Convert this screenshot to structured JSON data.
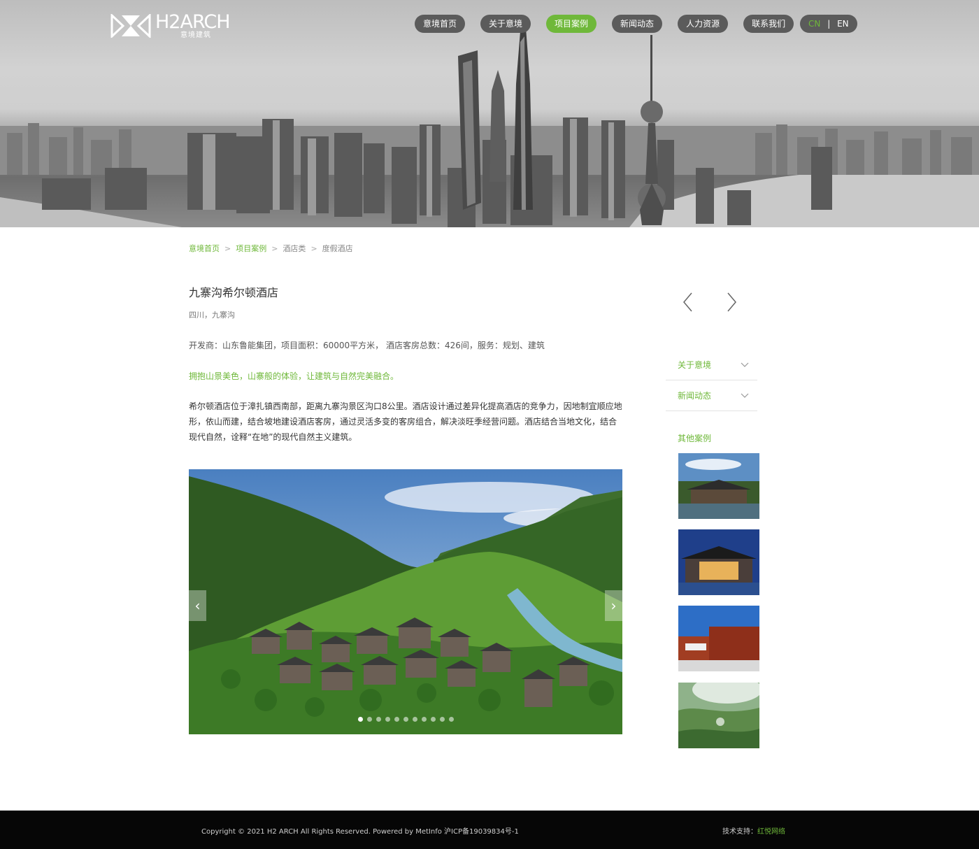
{
  "header": {
    "logo_text": "H2ARCH",
    "logo_subtext": "意境建筑",
    "nav": [
      {
        "label": "意境首页"
      },
      {
        "label": "关于意境"
      },
      {
        "label": "项目案例"
      },
      {
        "label": "新闻动态"
      },
      {
        "label": "人力资源"
      },
      {
        "label": "联系我们"
      }
    ],
    "active_nav_index": 2,
    "lang": {
      "cn": "CN",
      "separator": "|",
      "en": "EN"
    }
  },
  "breadcrumb": [
    {
      "label": "意境首页"
    },
    {
      "label": "项目案例"
    },
    {
      "label": "酒店类"
    },
    {
      "label": "度假酒店"
    }
  ],
  "project": {
    "title": "九寨沟希尔顿酒店",
    "location": "四川，九寨沟",
    "meta": "开发商：山东鲁能集团，项目面积：60000平方米， 酒店客房总数：426间，服务：规划、建筑",
    "tagline": "拥抱山景美色，山寨般的体验，让建筑与自然完美融合。",
    "description": "希尔顿酒店位于漳扎镇西南部，距离九寨沟景区沟口8公里。酒店设计通过差异化提高酒店的竞争力，因地制宜顺应地形，依山而建，结合坡地建设酒店客房，通过灵活多变的客房组合，解决淡旺季经营问题。酒店结合当地文化，结合现代自然，诠释“在地”的现代自然主义建筑。"
  },
  "gallery": {
    "slide_count": 11,
    "active_slide_index": 0
  },
  "sidebar": {
    "menu": [
      {
        "label": "关于意境"
      },
      {
        "label": "新闻动态"
      }
    ],
    "other_cases_title": "其他案例"
  },
  "footer": {
    "copyright": "Copyright © 2021 H2 ARCH All Rights Reserved. Powered by MetInfo 沪ICP备19039834号-1",
    "tech_label": "技术支持：",
    "tech_link": "红悦网络"
  },
  "colors": {
    "accent": "#6fb83a",
    "nav_bg": "#5b5b5b",
    "footer_bg": "#060606"
  }
}
